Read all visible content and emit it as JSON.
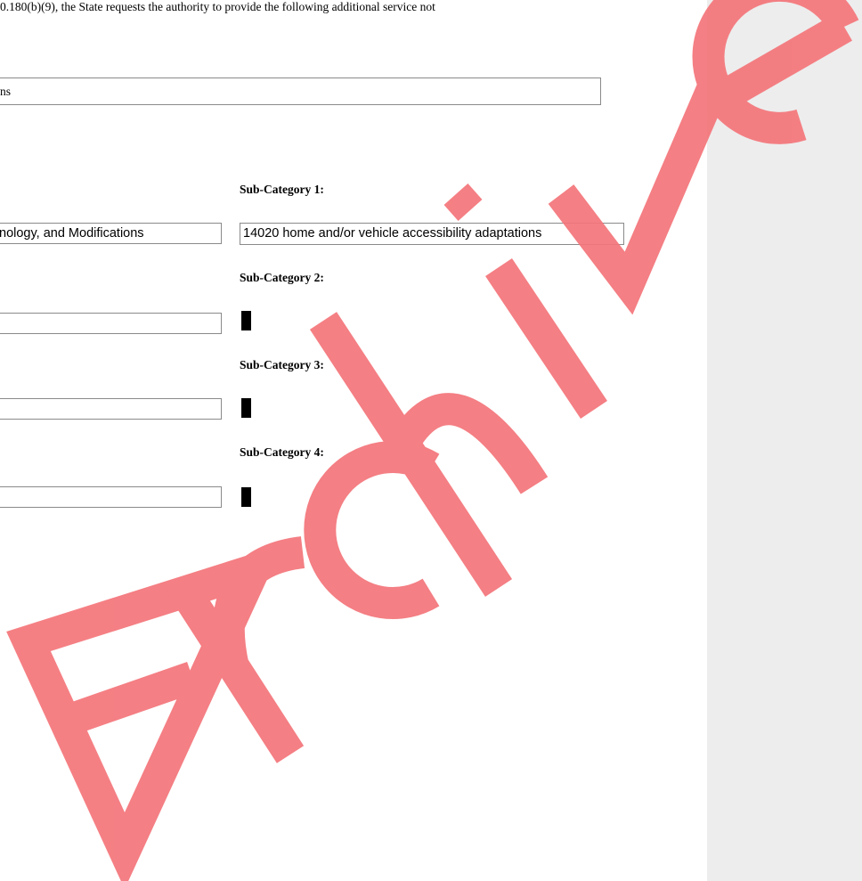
{
  "document": {
    "intro_line": "0.180(b)(9), the State requests the authority to provide the following additional service not",
    "service_title_visible": "ns",
    "category_1_visible": "nology, and Modifications",
    "category_2_value": "",
    "category_3_value": "",
    "category_4_value": "",
    "sub_categories": [
      {
        "label": "Sub-Category 1:",
        "value": "14020 home and/or vehicle accessibility adaptations"
      },
      {
        "label": "Sub-Category 2:",
        "value": ""
      },
      {
        "label": "Sub-Category 3:",
        "value": ""
      },
      {
        "label": "Sub-Category 4:",
        "value": ""
      }
    ]
  },
  "watermark": {
    "text": "Archive",
    "color": "#f4757a"
  },
  "colors": {
    "sidebar_background": "#ededed",
    "field_border": "#8a8a8a"
  }
}
